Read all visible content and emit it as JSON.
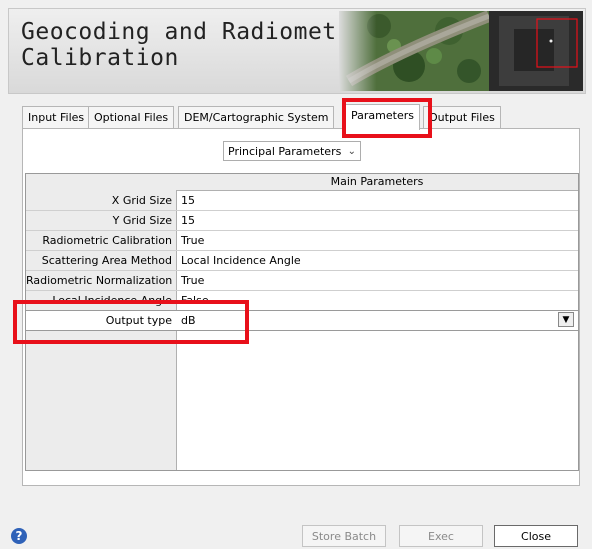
{
  "header": {
    "title": "Geocoding and Radiometric\nCalibration"
  },
  "tabs": [
    {
      "label": "Input Files"
    },
    {
      "label": "Optional Files"
    },
    {
      "label": "DEM/Cartographic System"
    },
    {
      "label": "Parameters"
    },
    {
      "label": "Output Files"
    }
  ],
  "active_tab": "Parameters",
  "section_selector": {
    "value": "Principal Parameters"
  },
  "grid": {
    "header": "Main Parameters",
    "rows": [
      {
        "label": "X Grid Size",
        "value": "15"
      },
      {
        "label": "Y Grid Size",
        "value": "15"
      },
      {
        "label": "Radiometric Calibration",
        "value": "True"
      },
      {
        "label": "Scattering Area Method",
        "value": "Local Incidence Angle"
      },
      {
        "label": "Radiometric Normalization",
        "value": "True"
      },
      {
        "label": "Local Incidence Angle",
        "value": "False"
      },
      {
        "label": "Output type",
        "value": "dB"
      }
    ]
  },
  "buttons": {
    "store_batch": "Store Batch",
    "exec": "Exec",
    "close": "Close",
    "help": "?"
  },
  "colors": {
    "highlight": "#e8101a",
    "help_icon": "#2f62b8"
  }
}
